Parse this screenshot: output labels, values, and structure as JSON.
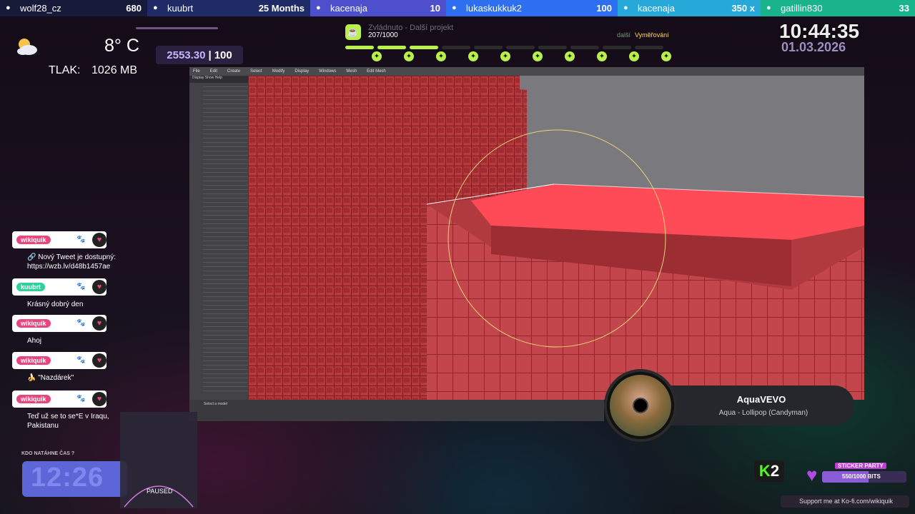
{
  "events": [
    {
      "icon": "user-plus-icon",
      "name": "wolf28_cz",
      "value": "680",
      "bg": "#181a3a"
    },
    {
      "icon": "crown-icon",
      "name": "kuubrt",
      "value": "25 Months",
      "bg": "#1f2a66"
    },
    {
      "icon": "diamond-icon",
      "name": "kacenaja",
      "value": "10",
      "bg": "#4e4fcc"
    },
    {
      "icon": "bits-icon",
      "name": "lukaskukkuk2",
      "value": "100",
      "bg": "#2e6ff2"
    },
    {
      "icon": "gift-icon",
      "name": "kacenaja",
      "value": "350 x",
      "bg": "#26a9d8"
    },
    {
      "icon": "users-icon",
      "name": "gatillin830",
      "value": "33",
      "bg": "#19b38c"
    }
  ],
  "weather": {
    "icon": "partly-cloudy-icon",
    "temp": "8° C",
    "pressure_label": "TLAK:",
    "pressure_value": "1026 MB"
  },
  "score": {
    "current": "2553.30",
    "total": "100"
  },
  "hud": {
    "title": "Zvládnuto - Další projekt",
    "count": "207/1000",
    "next_label": "další",
    "next": "Vyměřování",
    "progress": 0.207
  },
  "clock": {
    "time": "10:44:35",
    "date": "01.03.2026"
  },
  "chat": [
    {
      "user": "wikiquik",
      "user_color": "#e8457c",
      "text": "🔗 Nový Tweet je dostupný: https://wzb.lv/d48b1457ae"
    },
    {
      "user": "kuubrt",
      "user_color": "#2fd19a",
      "text": "Krásný dobrý den"
    },
    {
      "user": "wikiquik",
      "user_color": "#e8457c",
      "text": "Ahoj"
    },
    {
      "user": "wikiquik",
      "user_color": "#e8457c",
      "text": "🍌 \"Nazdárek\""
    },
    {
      "user": "wikiquik",
      "user_color": "#e8457c",
      "text": "Teď už se to se*E v Iraqu, Pakistanu"
    }
  ],
  "timer": {
    "label": "KDO NATÁHNE ČAS ?",
    "value": "12:26"
  },
  "paused": "PAUSED",
  "music": {
    "artist": "AquaVEVO",
    "song": "Aqua - Lollipop (Candyman)"
  },
  "k2": {
    "k": "K",
    "n": "2"
  },
  "sticker": {
    "title": "STICKER PARTY",
    "text": "550/1000 BITS",
    "progress": 0.55
  },
  "kofi": "Support me at Ko-fi.com/wikiquik",
  "editor": {
    "menu": [
      "File",
      "Edit",
      "Create",
      "Select",
      "Modify",
      "Display",
      "Windows",
      "Mesh",
      "Edit Mesh"
    ],
    "outliner_header": "Display  Show  Help",
    "timeline_text": "Select a model"
  }
}
